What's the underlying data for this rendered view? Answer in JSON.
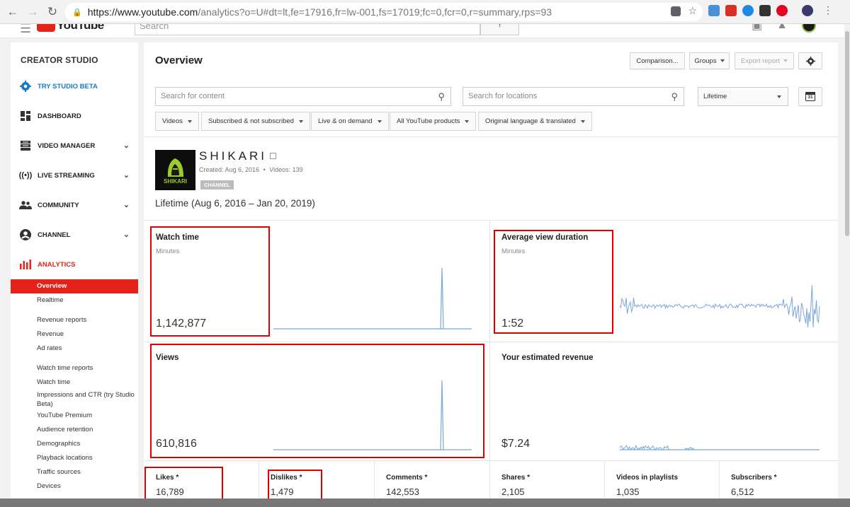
{
  "browser": {
    "url_host": "https://www.youtube.com",
    "url_path": "/analytics?o=U#dt=lt,fe=17916,fr=lw-001,fs=17019;fc=0,fcr=0,r=summary,rps=93"
  },
  "youtube_bar": {
    "logo_text": "YouTube",
    "search_placeholder": "Search"
  },
  "sidebar": {
    "title": "CREATOR STUDIO",
    "beta": "TRY STUDIO BETA",
    "items": [
      {
        "label": "DASHBOARD"
      },
      {
        "label": "VIDEO MANAGER"
      },
      {
        "label": "LIVE STREAMING"
      },
      {
        "label": "COMMUNITY"
      },
      {
        "label": "CHANNEL"
      },
      {
        "label": "ANALYTICS"
      }
    ],
    "analytics_sub": [
      "Overview",
      "Realtime",
      "Revenue reports",
      "Revenue",
      "Ad rates",
      "Watch time reports",
      "Watch time",
      "Impressions and CTR (try Studio Beta)",
      "YouTube Premium",
      "Audience retention",
      "Demographics",
      "Playback locations",
      "Traffic sources",
      "Devices"
    ]
  },
  "main": {
    "title": "Overview",
    "buttons": {
      "comparison": "Comparison...",
      "groups": "Groups",
      "export": "Export report"
    },
    "search_content_placeholder": "Search for content",
    "search_locations_placeholder": "Search for locations",
    "date_range": "Lifetime",
    "calendar_day": "31",
    "filters": [
      "Videos",
      "Subscribed & not subscribed",
      "Live & on demand",
      "All YouTube products",
      "Original language & translated"
    ],
    "channel": {
      "name": "SHIKARI",
      "thumb_text": "SHIKARI",
      "created": "Created: Aug 6, 2016",
      "separator": "•",
      "videos": "Videos: 139",
      "badge": "CHANNEL"
    },
    "period": "Lifetime (Aug 6, 2016 – Jan 20, 2019)",
    "cards": {
      "watch_time": {
        "label": "Watch time",
        "unit": "Minutes",
        "value": "1,142,877"
      },
      "avg_view_duration": {
        "label": "Average view duration",
        "unit": "Minutes",
        "value": "1:52"
      },
      "views": {
        "label": "Views",
        "value": "610,816"
      },
      "revenue": {
        "label": "Your estimated revenue",
        "value": "$7.24"
      }
    },
    "bottom_metrics": [
      {
        "label": "Likes *",
        "value": "16,789"
      },
      {
        "label": "Dislikes *",
        "value": "1,479"
      },
      {
        "label": "Comments *",
        "value": "142,553"
      },
      {
        "label": "Shares *",
        "value": "2,105"
      },
      {
        "label": "Videos in playlists",
        "value": "1,035"
      },
      {
        "label": "Subscribers *",
        "value": "6,512"
      }
    ]
  },
  "colors": {
    "accent_red": "#e62117",
    "link_blue": "#167ac6",
    "sparkline": "#7aa6dc",
    "highlight_red": "#e00000"
  }
}
